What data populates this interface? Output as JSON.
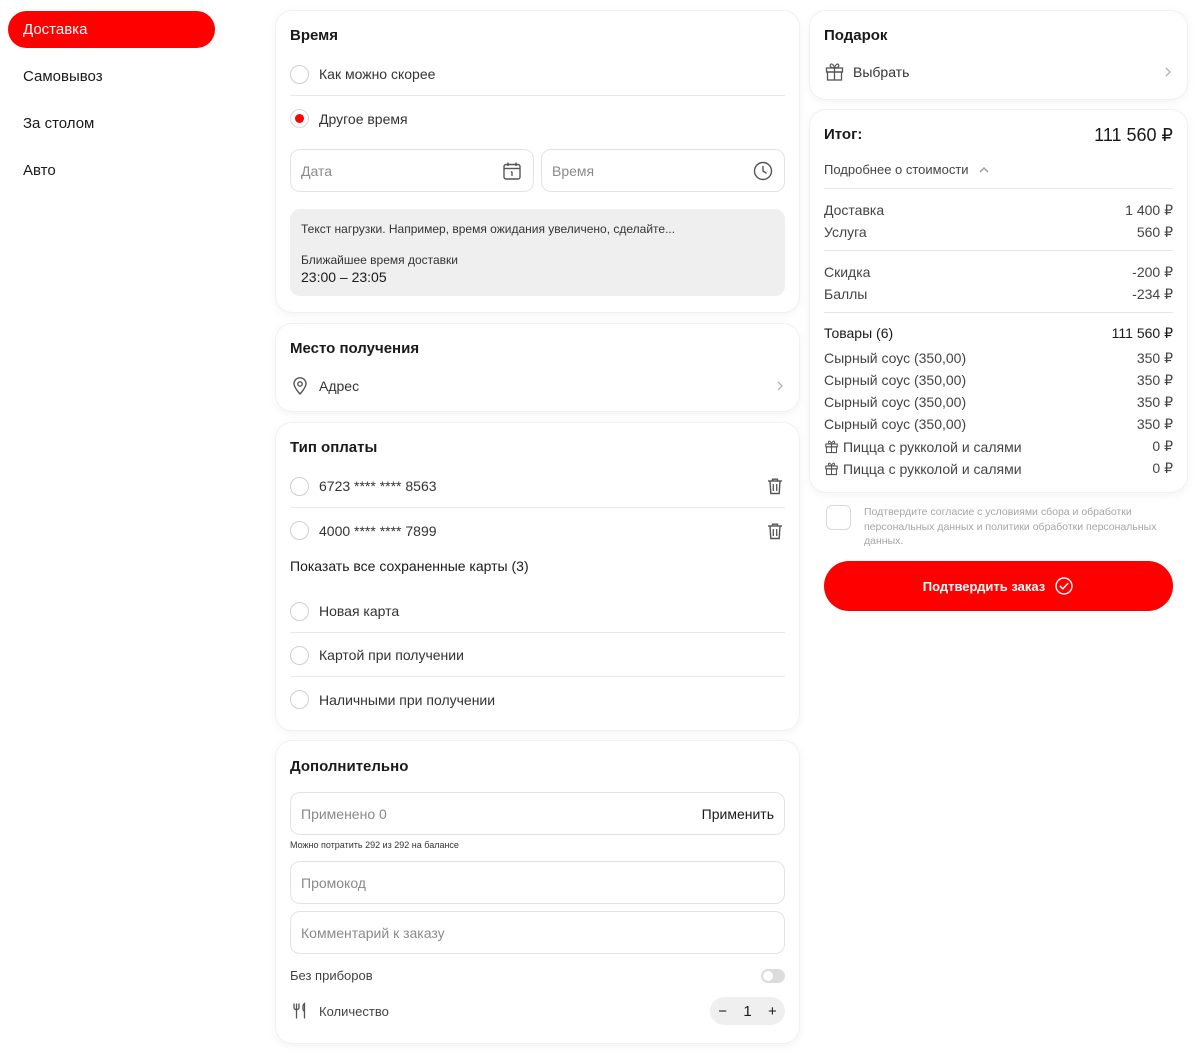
{
  "sidebar": {
    "items": [
      {
        "label": "Доставка",
        "active": true
      },
      {
        "label": "Самовывоз",
        "active": false
      },
      {
        "label": "За столом",
        "active": false
      },
      {
        "label": "Авто",
        "active": false
      }
    ]
  },
  "time": {
    "title": "Время",
    "option_asap": "Как можно скорее",
    "option_other": "Другое время",
    "date_placeholder": "Дата",
    "time_placeholder": "Время",
    "info_text": "Текст нагрузки. Например, время ожидания увеличено, сделайте...",
    "nearest_label": "Ближайшее время доставки",
    "nearest_value": "23:00 – 23:05"
  },
  "place": {
    "title": "Место получения",
    "address_label": "Адрес"
  },
  "payment": {
    "title": "Тип оплаты",
    "cards": [
      "6723 **** **** 8563",
      "4000 **** **** 7899"
    ],
    "show_all": "Показать все сохраненные карты (3)",
    "options": [
      "Новая карта",
      "Картой при получении",
      "Наличными при получении"
    ]
  },
  "extra": {
    "title": "Дополнительно",
    "points_placeholder": "Применено 0",
    "apply_label": "Применить",
    "balance_note": "Можно потратить 292 из 292 на балансе",
    "promo_placeholder": "Промокод",
    "comment_placeholder": "Комментарий к заказу",
    "no_cutlery": "Без приборов",
    "quantity_label": "Количество",
    "quantity_value": "1",
    "minus": "−",
    "plus": "+"
  },
  "gift": {
    "title": "Подарок",
    "choose_label": "Выбрать"
  },
  "summary": {
    "total_label": "Итог:",
    "total_value": "111 560 ₽",
    "details_label": "Подробнее о стоимости",
    "delivery_label": "Доставка",
    "delivery_value": "1 400 ₽",
    "service_label": "Услуга",
    "service_value": "560 ₽",
    "discount_label": "Скидка",
    "discount_value": "-200 ₽",
    "points_label": "Баллы",
    "points_value": "-234 ₽",
    "goods_label": "Товары (6)",
    "goods_value": "111 560 ₽",
    "items": [
      {
        "name": "Сырный соус (350,00)",
        "price": "350 ₽",
        "gift": false
      },
      {
        "name": "Сырный соус (350,00)",
        "price": "350 ₽",
        "gift": false
      },
      {
        "name": "Сырный соус (350,00)",
        "price": "350 ₽",
        "gift": false
      },
      {
        "name": "Сырный соус (350,00)",
        "price": "350 ₽",
        "gift": false
      },
      {
        "name": "Пицца с рукколой и салями",
        "price": "0 ₽",
        "gift": true
      },
      {
        "name": "Пицца с рукколой и салями",
        "price": "0 ₽",
        "gift": true
      }
    ]
  },
  "consent": {
    "text": "Подтвердите согласие с условиями сбора и обработки персональных данных и политики обработки персональных данных."
  },
  "confirm": {
    "label": "Подтвердить заказ"
  },
  "colors": {
    "accent": "#ff0000",
    "text": "#1a1a1a",
    "muted": "#8a8a8a",
    "border": "#e3e3e3",
    "info_bg": "#efefef"
  }
}
